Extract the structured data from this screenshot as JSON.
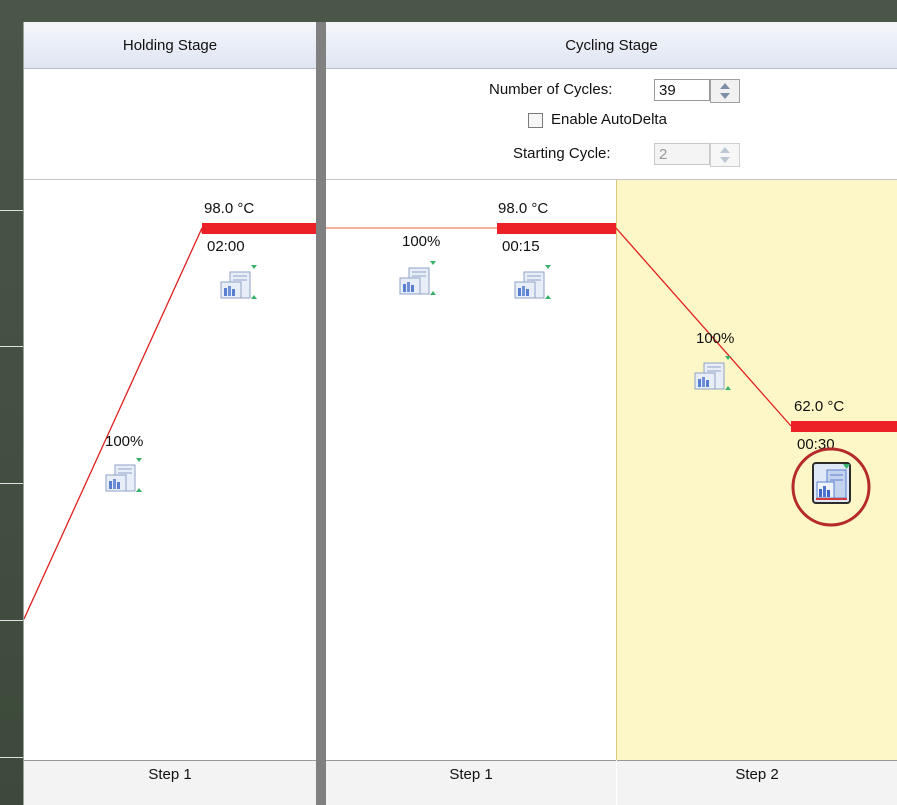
{
  "stages": {
    "holding": {
      "title": "Holding Stage",
      "step_label": "Step 1",
      "temp": "98.0 °C",
      "time": "02:00",
      "ramp": "100%"
    },
    "cycling": {
      "title": "Cycling Stage",
      "cycles_label": "Number of Cycles:",
      "cycles_value": "39",
      "autodelta_label": "Enable AutoDelta",
      "starting_cycle_label": "Starting Cycle:",
      "starting_cycle_value": "2",
      "step1": {
        "step_label": "Step 1",
        "temp": "98.0 °C",
        "time": "00:15",
        "ramp": "100%"
      },
      "step2": {
        "step_label": "Step 2",
        "temp": "62.0 °C",
        "time": "00:30",
        "ramp": "100%"
      }
    }
  },
  "colors": {
    "hold_bar": "#ec2127",
    "ramp_line": "#e02020",
    "highlight": "#fdf6c6",
    "circle": "#b52a2a"
  },
  "icons": [
    "data-collection-icon"
  ]
}
